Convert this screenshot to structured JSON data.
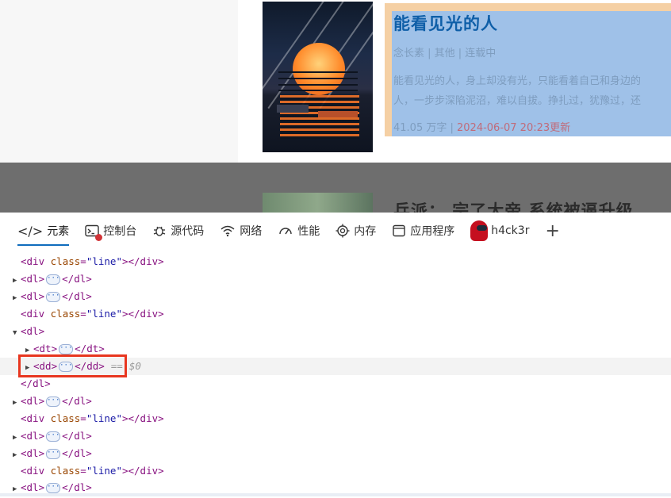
{
  "book": {
    "title": "能看见光的人",
    "meta": "念长素 | 其他 | 连载中",
    "desc_line1": "能看见光的人，身上却没有光，只能看着自己和身边的",
    "desc_line2": "人，一步步深陷泥沼，难以自拔。挣扎过，犹豫过，还",
    "foot_words": "41.05 万字 | ",
    "foot_time": "2024-06-07 20:23更新"
  },
  "book2": {
    "title_partial": "兵派：  宗了大帝  系统被逼升级"
  },
  "devtools": {
    "tabs": [
      {
        "label": "元素",
        "icon": "elements-icon"
      },
      {
        "label": "控制台",
        "icon": "console-icon"
      },
      {
        "label": "源代码",
        "icon": "sources-icon"
      },
      {
        "label": "网络",
        "icon": "wifi-icon"
      },
      {
        "label": "性能",
        "icon": "performance-icon"
      },
      {
        "label": "内存",
        "icon": "memory-icon"
      },
      {
        "label": "应用程序",
        "icon": "application-icon"
      },
      {
        "label": "h4ck3r",
        "icon": "amongus-avatar-icon"
      }
    ],
    "add_tab": "+"
  },
  "tree": {
    "div": "div",
    "class_attr": "class",
    "line_val": "\"line\"",
    "dl": "dl",
    "dt": "dt",
    "dd": "dd",
    "selected_ref": "$0",
    "eq": "=="
  },
  "colors": {
    "highlight_box": "#e8361f",
    "selection": "#9fc1e8",
    "tab_underline": "#0f6cbd"
  }
}
